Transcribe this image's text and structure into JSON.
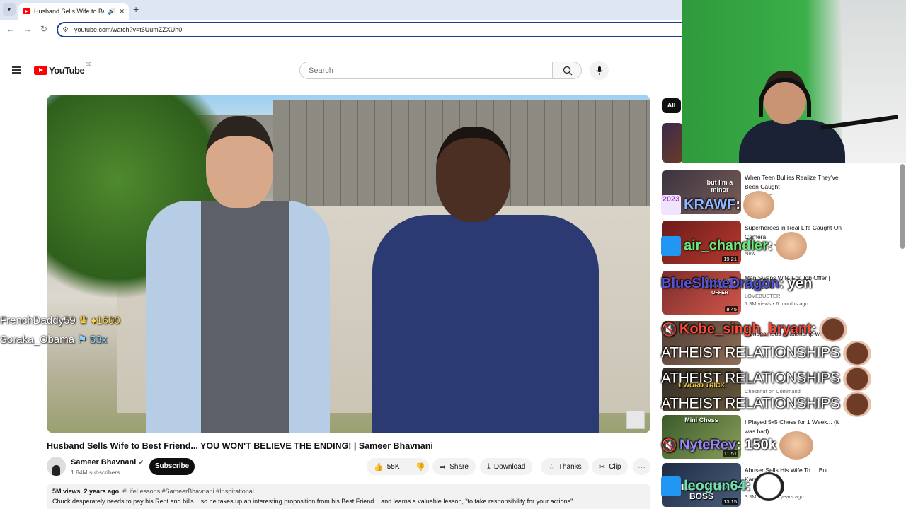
{
  "browser": {
    "tab_title": "Husband Sells Wife to Best",
    "url": "youtube.com/watch?v=t6UumZZXUh0"
  },
  "youtube": {
    "logo": "YouTube",
    "country": "SE",
    "search_placeholder": "Search"
  },
  "video": {
    "title": "Husband Sells Wife to Best Friend... YOU WON'T BELIEVE THE ENDING! | Sameer Bhavnani",
    "channel": "Sameer Bhavnani",
    "subscribers": "1.84M subscribers",
    "subscribe_label": "Subscribe",
    "likes": "55K",
    "actions": {
      "share": "Share",
      "download": "Download",
      "thanks": "Thanks",
      "clip": "Clip"
    },
    "views": "5M views",
    "age": "2 years ago",
    "tags": "#LifeLessons #SameerBhavnani #Inspirational",
    "description": "Chuck desperately needs to pay his Rent and bills... so he takes up an interesting proposition from his Best Friend... and learns a valuable lesson, \"to take responsibility for your actions\""
  },
  "overlay_chat": [
    {
      "user": "FrenchDaddy59",
      "badge": "♛",
      "value": "♦1600"
    },
    {
      "user": "Soraka_Obama",
      "badge": "⚑",
      "value": "53x"
    }
  ],
  "filter_chip": "All",
  "recommendations": [
    {
      "title": "When Teen Bullies Realize They've Been Caught",
      "meta": "2 years ago",
      "thumb_text": "but I'm a minor",
      "duration": ""
    },
    {
      "title": "Superheroes in Real Life Caught On Camera",
      "meta": "64K views • 3 d",
      "meta2": "New",
      "thumb_text": "",
      "duration": "19:21"
    },
    {
      "title": "Man Swaps Wife For Job Offer | LoveBuster",
      "meta": "LOVEBUSTER",
      "meta2": "1.3M views • 6 months ago",
      "thumb_text": "MAN SWAPS WIFE FOR JOB OFFER",
      "duration": "8:45"
    },
    {
      "title": "monogamous relationship wh...",
      "meta": "",
      "thumb_text": "",
      "duration": ""
    },
    {
      "title": "",
      "meta": "Chessnut on Command",
      "thumb_text": "1 WORD TRICK",
      "duration": ""
    },
    {
      "title": "I Played 5x5 Chess for 1 Week... (it was bad)",
      "meta": "",
      "thumb_text": "Mini Chess",
      "duration": "11:51"
    },
    {
      "title": "Abuser Sells His Wife To ... But Karma I...",
      "meta": "3.3M views • 2 years ago",
      "thumb_text": "HIS WIFE TO BOSS",
      "duration": "13:15"
    }
  ],
  "stream_chat": [
    {
      "user": "KRAWF",
      "badge": "2023",
      "message": ""
    },
    {
      "user": "air_chandler",
      "badge": "crown",
      "message": ""
    },
    {
      "user": "BlueSlimeDragon",
      "badge": "",
      "message": "yen"
    },
    {
      "user": "Kobe_singh_bryant",
      "badge": "mute",
      "message": ""
    },
    {
      "user": "",
      "badge": "",
      "message": "ATHEIST RELATIONSHIPS"
    },
    {
      "user": "",
      "badge": "",
      "message": "ATHEIST RELATIONSHIPS"
    },
    {
      "user": "",
      "badge": "",
      "message": "ATHEIST RELATIONSHIPS"
    },
    {
      "user": "NyteRev",
      "badge": "mute",
      "message": "150k"
    },
    {
      "user": "leogun64",
      "badge": "crown",
      "message": ""
    }
  ]
}
